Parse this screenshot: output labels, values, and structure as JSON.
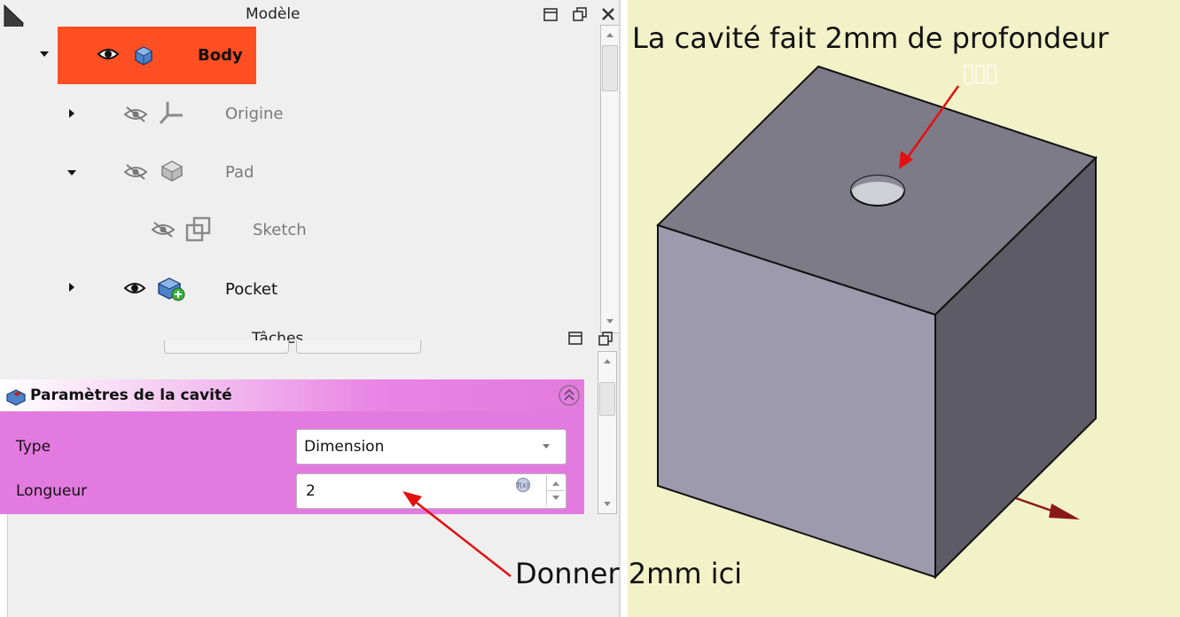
{
  "model_panel": {
    "title": "Modèle",
    "tree": [
      {
        "label": "Body",
        "visible": true,
        "selected": true,
        "expanded": true
      },
      {
        "label": "Origine",
        "visible": false,
        "expanded": false
      },
      {
        "label": "Pad",
        "visible": false,
        "expanded": true
      },
      {
        "label": "Sketch",
        "visible": false
      },
      {
        "label": "Pocket",
        "visible": true,
        "expanded": false
      }
    ]
  },
  "tasks_panel": {
    "title": "Tâches",
    "section_title": "Paramètres de la cavité",
    "type_label": "Type",
    "type_value": "Dimension",
    "length_label": "Longueur",
    "length_value": "2"
  },
  "annotations": {
    "top": "La cavité fait 2mm de profondeur",
    "bottom": "Donner 2mm ici"
  },
  "colors": {
    "selection": "#ff4f23",
    "task_panel": "#e37ae0",
    "viewport_bg": "#f2f2c8",
    "arrow": "#e31010"
  }
}
